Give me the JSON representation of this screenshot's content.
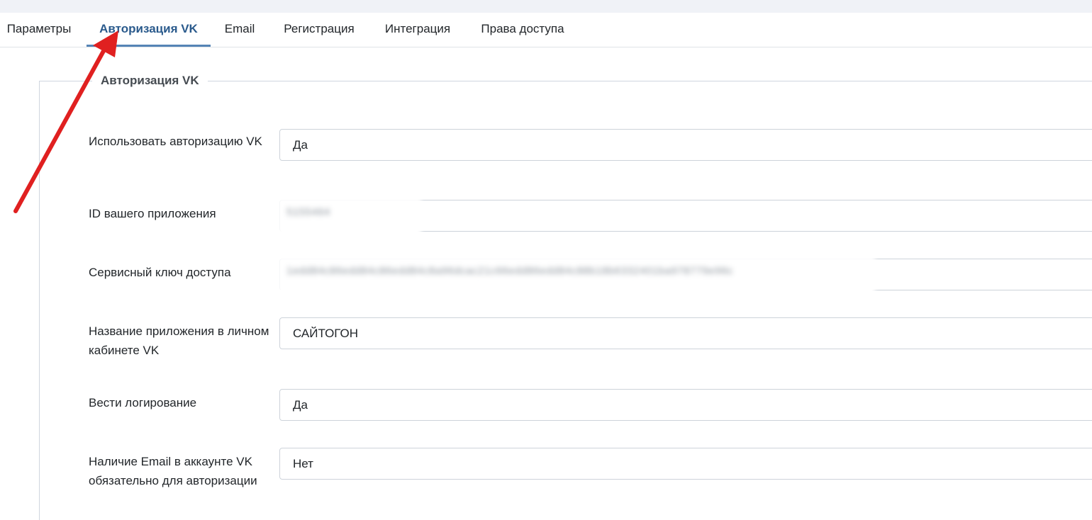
{
  "tabs": [
    {
      "label": "Параметры"
    },
    {
      "label": "Авторизация VK",
      "active": true
    },
    {
      "label": "Email"
    },
    {
      "label": "Регистрация"
    },
    {
      "label": "Интеграция"
    },
    {
      "label": "Права доступа"
    }
  ],
  "fieldset": {
    "legend": "Авторизация VK",
    "fields": [
      {
        "label": "Использовать авторизацию VK",
        "value": "Да"
      },
      {
        "label": "ID вашего приложения",
        "value": "5155464"
      },
      {
        "label": "Сервисный ключ доступа",
        "value": "1edd84c86edd84c86edd84c8a96dcac21c66edd86edd84c88b18b6332401ba978779e96c"
      },
      {
        "label": "Название приложения в личном кабинете VK",
        "value": "САЙТОГОН"
      },
      {
        "label": "Вести логирование",
        "value": "Да"
      },
      {
        "label": "Наличие Email в аккаунте VK обязательно для авторизации",
        "value": "Нет"
      }
    ]
  },
  "colors": {
    "accent": "#2a5a8c",
    "tab_underline": "#5584b5",
    "annotation_arrow": "#e02020"
  }
}
